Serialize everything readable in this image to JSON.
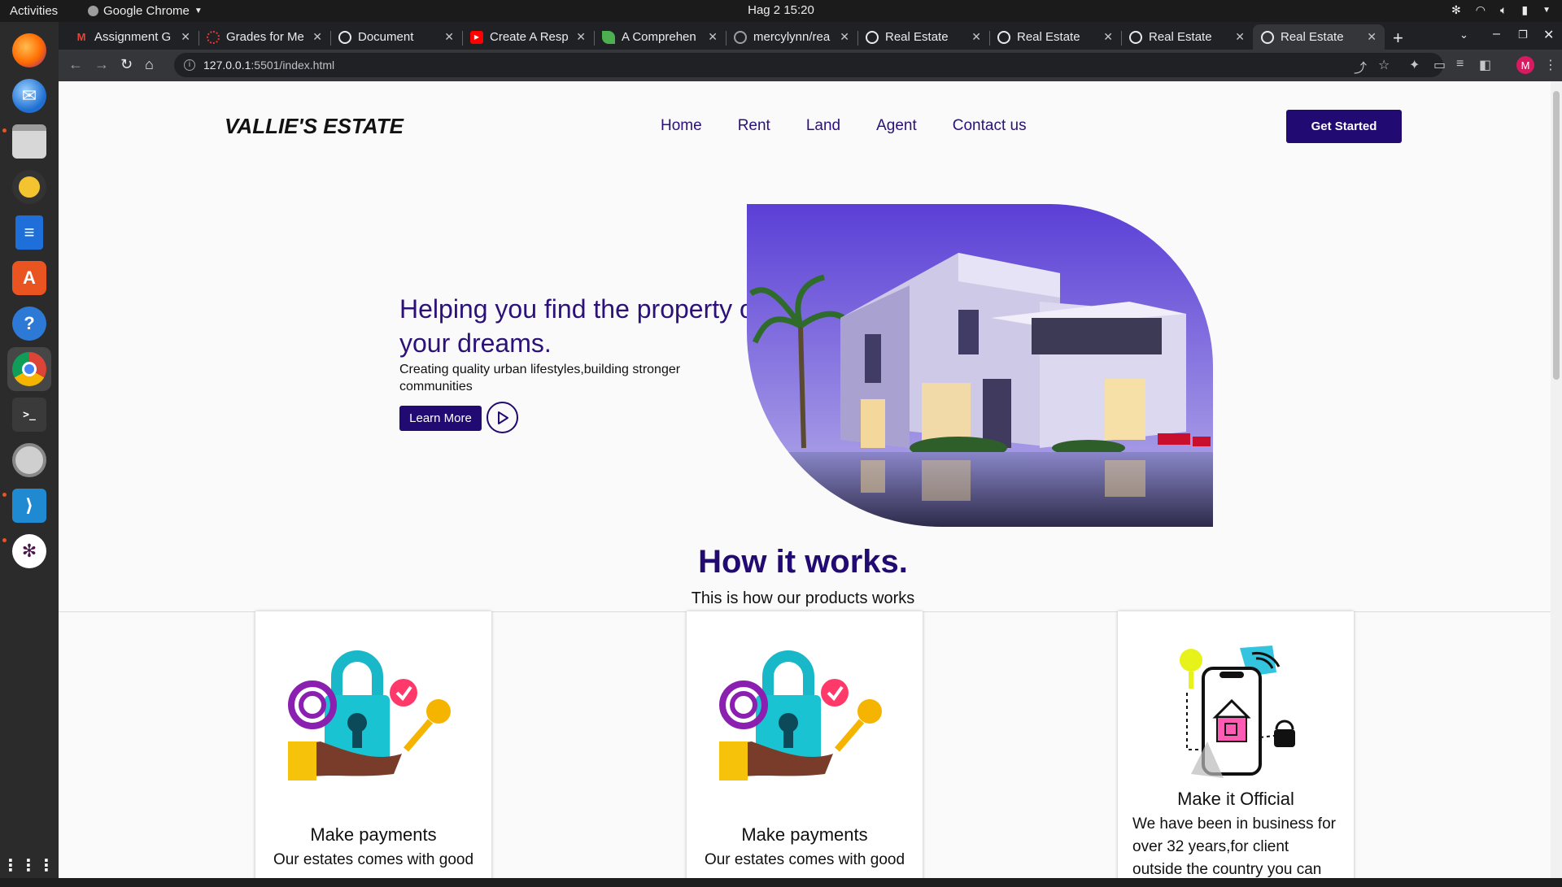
{
  "desktop": {
    "activities": "Activities",
    "app_name": "Google Chrome",
    "clock": "Hag 2  15:20"
  },
  "dock": {
    "items": [
      "firefox-icon",
      "thunderbird-icon",
      "files-icon",
      "rhythmbox-icon",
      "writer-icon",
      "software-icon",
      "help-icon",
      "chrome-icon",
      "terminal-icon",
      "magnifier-icon",
      "vscode-icon",
      "slack-icon",
      "apps-grid-icon"
    ]
  },
  "browser": {
    "tabs": [
      {
        "label": "Assignment G",
        "favicon": "gmail-icon"
      },
      {
        "label": "Grades for Me",
        "favicon": "moodle-icon"
      },
      {
        "label": "Document",
        "favicon": "globe-icon"
      },
      {
        "label": "Create A Resp",
        "favicon": "youtube-icon"
      },
      {
        "label": "A Comprehen",
        "favicon": "leaf-icon"
      },
      {
        "label": "mercylynn/rea",
        "favicon": "github-icon"
      },
      {
        "label": "Real Estate",
        "favicon": "globe-icon"
      },
      {
        "label": "Real Estate",
        "favicon": "globe-icon"
      },
      {
        "label": "Real Estate",
        "favicon": "globe-icon"
      },
      {
        "label": "Real Estate",
        "favicon": "globe-icon"
      }
    ],
    "url_host": "127.0.0.1",
    "url_rest": ":5501/index.html",
    "profile_initial": "M"
  },
  "site": {
    "brand": "VALLIE'S ESTATE",
    "nav": [
      "Home",
      "Rent",
      "Land",
      "Agent",
      "Contact us"
    ],
    "cta": "Get Started",
    "hero_title": "Helping you find the property of your dreams.",
    "hero_sub": "Creating quality urban lifestyles,building stronger communities",
    "learn_more": "Learn More",
    "how_title": "How it works.",
    "how_sub": "This is how our products works",
    "cards": [
      {
        "title": "Make payments",
        "desc": "Our estates comes with good"
      },
      {
        "title": "Make payments",
        "desc": "Our estates comes with good"
      },
      {
        "title": "Make it Official",
        "desc": "We have been in business for over 32 years,for client outside the country you can"
      }
    ]
  }
}
